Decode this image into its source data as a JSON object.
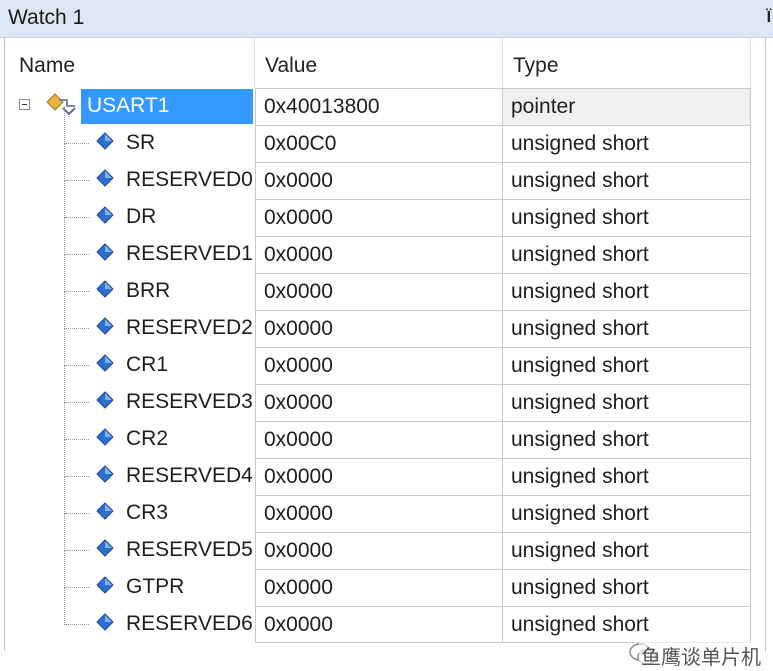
{
  "window": {
    "title": "Watch 1",
    "pin_glyph": "Ї"
  },
  "columns": {
    "name": "Name",
    "value": "Value",
    "type": "Type"
  },
  "parent": {
    "name": "USART1",
    "value": "0x40013800",
    "type": "pointer",
    "expanded": true
  },
  "members": [
    {
      "name": "SR",
      "value": "0x00C0",
      "type": "unsigned short"
    },
    {
      "name": "RESERVED0",
      "value": "0x0000",
      "type": "unsigned short"
    },
    {
      "name": "DR",
      "value": "0x0000",
      "type": "unsigned short"
    },
    {
      "name": "RESERVED1",
      "value": "0x0000",
      "type": "unsigned short"
    },
    {
      "name": "BRR",
      "value": "0x0000",
      "type": "unsigned short"
    },
    {
      "name": "RESERVED2",
      "value": "0x0000",
      "type": "unsigned short"
    },
    {
      "name": "CR1",
      "value": "0x0000",
      "type": "unsigned short"
    },
    {
      "name": "RESERVED3",
      "value": "0x0000",
      "type": "unsigned short"
    },
    {
      "name": "CR2",
      "value": "0x0000",
      "type": "unsigned short"
    },
    {
      "name": "RESERVED4",
      "value": "0x0000",
      "type": "unsigned short"
    },
    {
      "name": "CR3",
      "value": "0x0000",
      "type": "unsigned short"
    },
    {
      "name": "RESERVED5",
      "value": "0x0000",
      "type": "unsigned short"
    },
    {
      "name": "GTPR",
      "value": "0x0000",
      "type": "unsigned short"
    },
    {
      "name": "RESERVED6",
      "value": "0x0000",
      "type": "unsigned short"
    }
  ],
  "watermark": {
    "text": "鱼鹰谈单片机"
  },
  "colors": {
    "selection": "#3399ff",
    "titlebar": "#dde6f3",
    "member_icon": "#2e6fd0",
    "struct_icon": "#e8b43a"
  }
}
